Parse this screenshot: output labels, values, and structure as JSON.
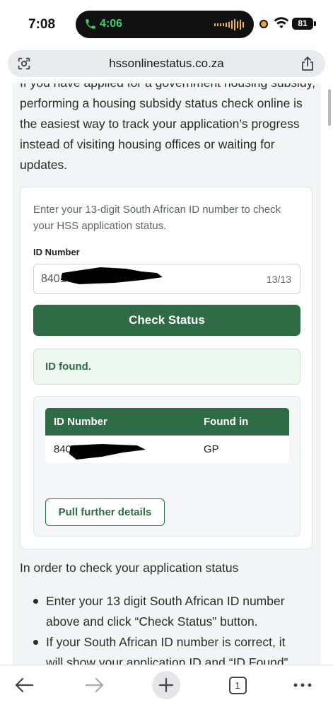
{
  "status_bar": {
    "time": "7:08",
    "call_time": "4:06",
    "battery": "81"
  },
  "browser": {
    "url": "hssonlinestatus.co.za",
    "tab_count": "1"
  },
  "page": {
    "intro_text": "If you have applied for a government housing subsidy, performing a housing subsidy status check online is the easiest way to track your application’s progress instead of visiting housing offices or waiting for updates.",
    "form": {
      "description": "Enter your 13-digit South African ID number to check your HSS application status.",
      "id_label": "ID Number",
      "id_value": "8401",
      "char_count": "13/13",
      "check_button": "Check Status"
    },
    "alert": {
      "message": "ID found."
    },
    "result": {
      "columns": [
        "ID Number",
        "Found in"
      ],
      "rows": [
        [
          "840",
          "GP"
        ]
      ],
      "pull_button": "Pull further details"
    },
    "instructions": {
      "title": "In order to check your application status",
      "items": [
        "Enter your 13 digit South African ID number above and click “Check Status” button.",
        "If your South African ID number is correct, it will show your application ID and “ID Found”"
      ]
    }
  },
  "colors": {
    "primary_green": "#2f6b44",
    "alert_bg": "#edf8f1",
    "call_green": "#36d16a"
  },
  "icons": {
    "back": "arrow-left-icon",
    "forward": "arrow-right-icon",
    "new_tab": "plus-icon",
    "tabs": "tabs-icon",
    "more": "more-dots-icon",
    "share": "share-icon",
    "lens": "lens-icon"
  }
}
